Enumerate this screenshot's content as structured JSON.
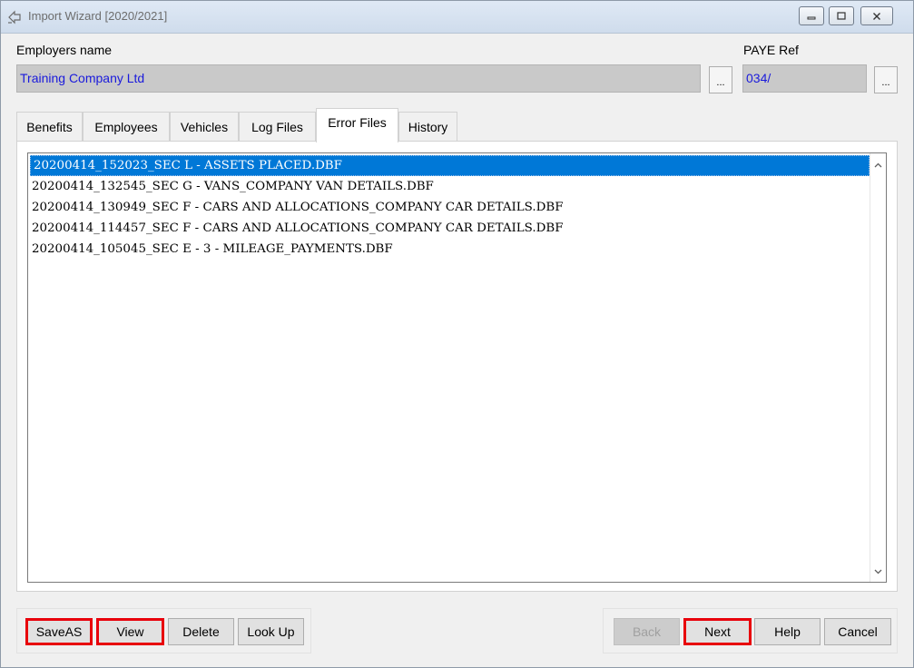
{
  "window": {
    "title": "Import Wizard [2020/2021]"
  },
  "employer": {
    "name_label": "Employers name",
    "name_value": "Training Company Ltd",
    "paye_label": "PAYE Ref",
    "paye_value": "034/",
    "browse_label": "..."
  },
  "tabs": [
    {
      "label": "Benefits",
      "active": false
    },
    {
      "label": "Employees",
      "active": false
    },
    {
      "label": "Vehicles",
      "active": false
    },
    {
      "label": "Log Files",
      "active": false
    },
    {
      "label": "Error Files",
      "active": true
    },
    {
      "label": "History",
      "active": false
    }
  ],
  "error_files": [
    "20200414_152023_SEC L - ASSETS PLACED.DBF",
    "20200414_132545_SEC G - VANS_COMPANY VAN DETAILS.DBF",
    "20200414_130949_SEC F - CARS AND ALLOCATIONS_COMPANY CAR DETAILS.DBF",
    "20200414_114457_SEC F - CARS AND ALLOCATIONS_COMPANY CAR DETAILS.DBF",
    "20200414_105045_SEC E - 3 - MILEAGE_PAYMENTS.DBF"
  ],
  "selected_index": 0,
  "left_buttons": {
    "saveas": "SaveAS",
    "view": "View",
    "delete": "Delete",
    "lookup": "Look Up"
  },
  "right_buttons": {
    "back": "Back",
    "next": "Next",
    "help": "Help",
    "cancel": "Cancel"
  },
  "colors": {
    "selection": "#0078d7",
    "field_text": "#1a1adc",
    "highlight_border": "#e8000b"
  }
}
